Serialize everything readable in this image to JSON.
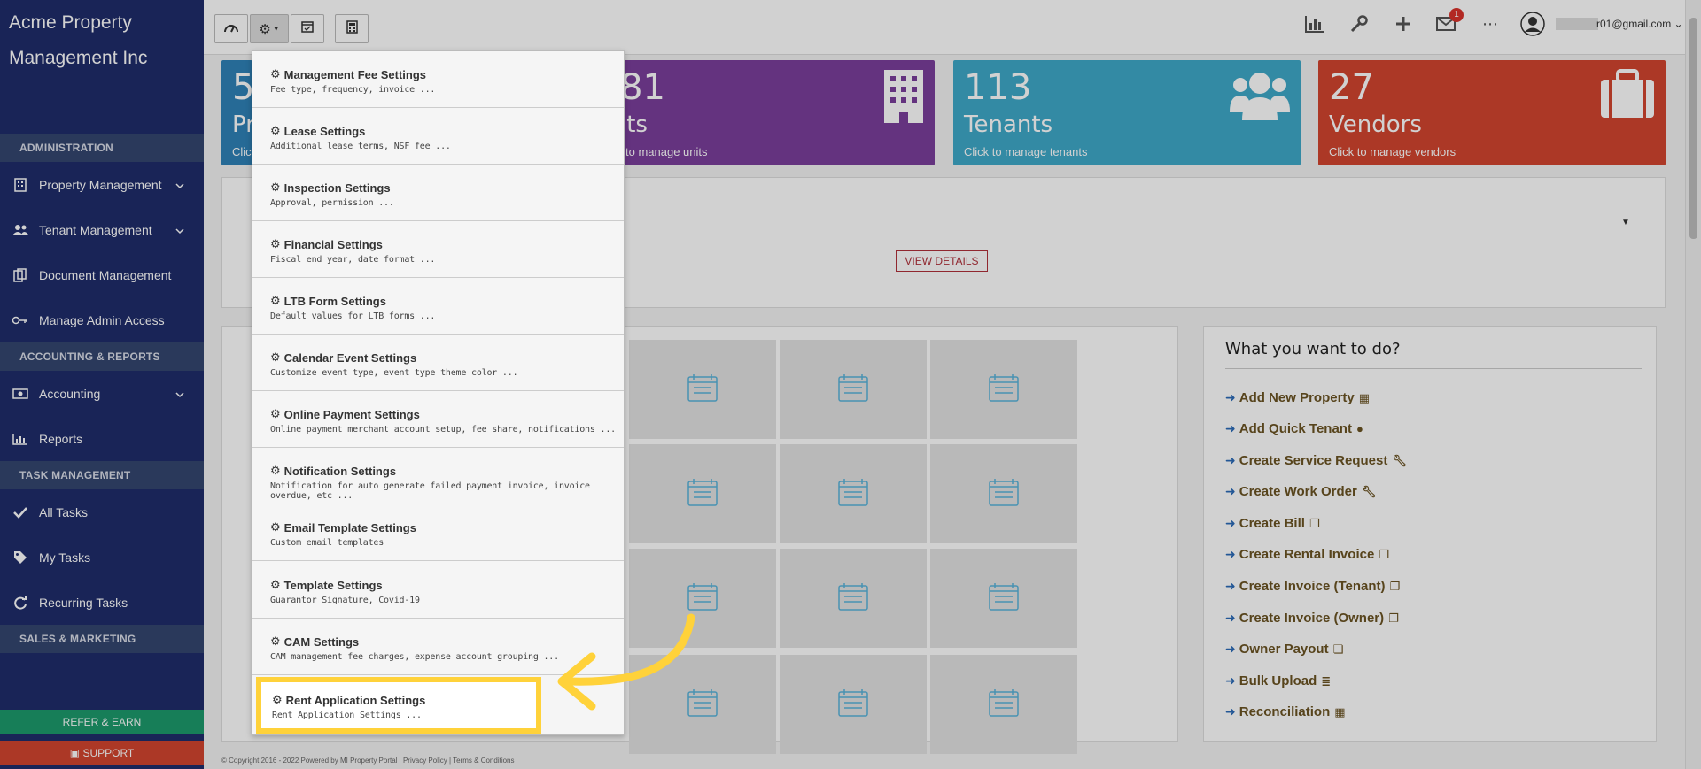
{
  "sidebar": {
    "brand_line1": "Acme Property",
    "brand_line2": "Management Inc",
    "sections": {
      "administration": "ADMINISTRATION",
      "accounting": "ACCOUNTING & REPORTS",
      "tasks": "TASK MANAGEMENT",
      "sales": "SALES & MARKETING"
    },
    "items": {
      "property_management": "Property Management",
      "tenant_management": "Tenant Management",
      "document_management": "Document Management",
      "manage_admin_access": "Manage Admin Access",
      "accounting": "Accounting",
      "reports": "Reports",
      "all_tasks": "All Tasks",
      "my_tasks": "My Tasks",
      "recurring_tasks": "Recurring Tasks"
    },
    "refer_label": "REFER & EARN",
    "support_label": "SUPPORT"
  },
  "topbar": {
    "notification_count": "1",
    "user_email": "r01@gmail.com"
  },
  "stats": [
    {
      "number": "5",
      "label": "Pr",
      "sub": "Clic",
      "color": "#2f82b8"
    },
    {
      "number": "81",
      "label": "its",
      "sub": "to manage units",
      "color": "#7b3f9c"
    },
    {
      "number": "113",
      "label": "Tenants",
      "sub": "Click to manage tenants",
      "color": "#3fa9c9"
    },
    {
      "number": "27",
      "label": "Vendors",
      "sub": "Click to manage vendors",
      "color": "#d2452f"
    }
  ],
  "view_details_label": "VIEW DETAILS",
  "actions": {
    "title": "What you want to do?",
    "items": [
      "Add New Property",
      "Add Quick Tenant",
      "Create Service Request",
      "Create Work Order",
      "Create Bill",
      "Create Rental Invoice",
      "Create Invoice (Tenant)",
      "Create Invoice (Owner)",
      "Owner Payout",
      "Bulk Upload",
      "Reconciliation"
    ]
  },
  "settings_menu": [
    {
      "title": "Management Fee Settings",
      "desc": "Fee type, frequency, invoice ..."
    },
    {
      "title": "Lease Settings",
      "desc": "Additional lease terms, NSF fee ..."
    },
    {
      "title": "Inspection Settings",
      "desc": "Approval, permission ..."
    },
    {
      "title": "Financial Settings",
      "desc": "Fiscal end year, date format ..."
    },
    {
      "title": "LTB Form Settings",
      "desc": "Default values for LTB forms ..."
    },
    {
      "title": "Calendar Event Settings",
      "desc": "Customize event type, event type theme color ..."
    },
    {
      "title": "Online Payment Settings",
      "desc": "Online payment merchant account setup, fee share, notifications ..."
    },
    {
      "title": "Notification Settings",
      "desc": "Notification for auto generate failed payment invoice, invoice overdue, etc ..."
    },
    {
      "title": "Email Template Settings",
      "desc": "Custom email templates"
    },
    {
      "title": "Template Settings",
      "desc": "Guarantor Signature, Covid-19"
    },
    {
      "title": "CAM Settings",
      "desc": "CAM management fee charges, expense account grouping ..."
    },
    {
      "title": "Rent Application Settings",
      "desc": "Rent Application Settings ..."
    }
  ],
  "footer_text": "© Copyright 2016 - 2022 Powered by MI Property Portal | Privacy Policy | Terms & Conditions"
}
